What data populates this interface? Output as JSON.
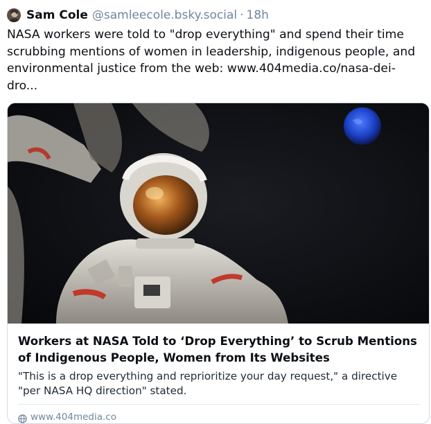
{
  "post": {
    "author_name": "Sam Cole",
    "author_handle": "@samleecole.bsky.social",
    "separator": "·",
    "timestamp": "18h",
    "text": "NASA workers were told to \"drop everything\" and spend their time scrubbing mentions of women in leadership, indigenous people, and environmental justice from the web: www.404media.co/nasa-dei-dro..."
  },
  "link_card": {
    "title": "Workers at NASA Told to ‘Drop Everything’ to Scrub Mentions of Indigenous People, Women from Its Websites",
    "description": "\"This is a drop everything and reprioritize your day request,\" a directive \"per NASA HQ direction\" stated.",
    "domain": "www.404media.co",
    "image_icon": "astronaut-photo"
  },
  "colors": {
    "text": "#0b0f14",
    "muted": "#6f869f",
    "border": "#d4dbe2",
    "background": "#ffffff"
  }
}
